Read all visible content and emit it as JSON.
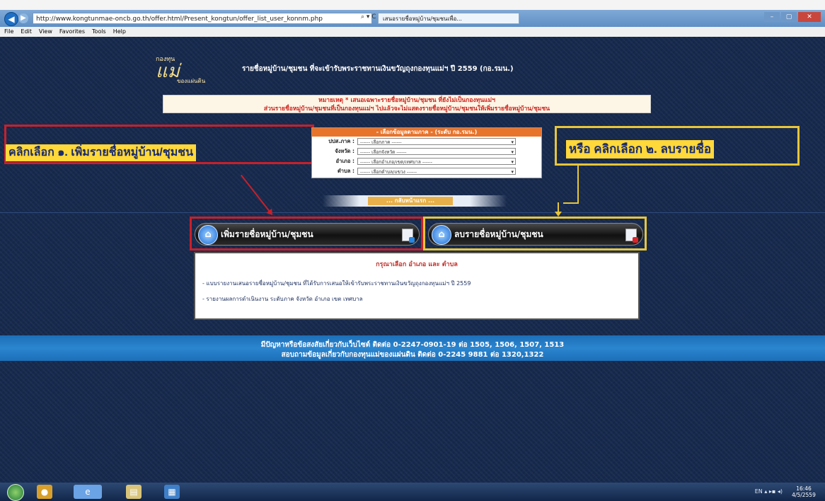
{
  "browser": {
    "url": "http://www.kongtunmae-oncb.go.th/offer.html/Present_kongtun/offer_list_user_konnm.php",
    "tab_title": "เสนอรายชื่อหมู่บ้าน/ชุมชนเพื่อ...",
    "address_tools": "⌕ ▾ C",
    "menu": [
      "File",
      "Edit",
      "View",
      "Favorites",
      "Tools",
      "Help"
    ]
  },
  "header": {
    "logo_small": "กองทุน",
    "logo_main": "แม่",
    "logo_sub": "ของแผ่นดิน",
    "title": "รายชื่อหมู่บ้าน/ชุมชน ที่จะเข้ารับพระราชทานเงินขวัญถุงกองทุนแม่ฯ ปี 2559 (กอ.รมน.)"
  },
  "note": {
    "line1": "หมายเหตุ * เสนอเฉพาะรายชื่อหมู่บ้าน/ชุมชน ที่ยังไม่เป็นกองทุนแม่ฯ",
    "line2": "ส่วนรายชื่อหมู่บ้าน/ชุมชนที่เป็นกองทุนแม่ฯ ไปแล้วจะไม่แสดงรายชื่อหมู่บ้าน/ชุมชนให้เพิ่มรายชื่อหมู่บ้าน/ชุมชน"
  },
  "selector": {
    "heading": "- เลือกข้อมูลตามภาค - (ระดับ กอ.รมน.)",
    "rows": [
      {
        "label": "ปปส.ภาค :",
        "value": "------ เลือกภาค ------"
      },
      {
        "label": "จังหวัด :",
        "value": "------ เลือกจังหวัด ------"
      },
      {
        "label": "อำเภอ :",
        "value": "------ เลือกอำเภอ/เขต/เทศบาล ------"
      },
      {
        "label": "ตำบล :",
        "value": "------ เลือกตำบล/แขวง ------"
      }
    ]
  },
  "annotations": {
    "left": "คลิกเลือก ๑. เพิ่มรายชื่อหมู่บ้าน/ชุมชน",
    "right": "หรือ คลิกเลือก ๒. ลบรายชื่อ"
  },
  "back_banner": "... กลับหน้าแรก ...",
  "buttons": {
    "add": "เพิ่มรายชื่อหมู่บ้าน/ชุมชน",
    "delete": "ลบรายชื่อหมู่บ้าน/ชุมชน"
  },
  "list": {
    "title": "กรุณาเลือก อำเภอ และ ตำบล",
    "items": [
      "- แบบรายงานเสนอรายชื่อหมู่บ้าน/ชุมชน ที่ได้รับการเสนอให้เข้ารับพระราชทานเงินขวัญถุงกองทุนแม่ฯ ปี 2559",
      "- รายงานผลการดำเนินงาน ระดับภาค จังหวัด อำเภอ เขต เทศบาล"
    ]
  },
  "footer": {
    "line1": "มีปัญหาหรือข้อสงสัยเกี่ยวกับเว็บไซต์ ติดต่อ 0-2247-0901-19 ต่อ 1505, 1506, 1507, 1513",
    "line2": "สอบถามข้อมูลเกี่ยวกับกองทุนแม่ของแผ่นดิน ติดต่อ 0-2245 9881 ต่อ 1320,1322"
  },
  "taskbar": {
    "tray": "EN  ▴  ▸▪  ◂)",
    "time": "16:46",
    "date": "4/5/2559"
  },
  "colors": {
    "page_bg": "#172a4e",
    "annotation_red": "#c8202a",
    "annotation_yellow": "#e7c53a",
    "highlight": "#ffd83a",
    "footer_band": "#2b85cf"
  }
}
